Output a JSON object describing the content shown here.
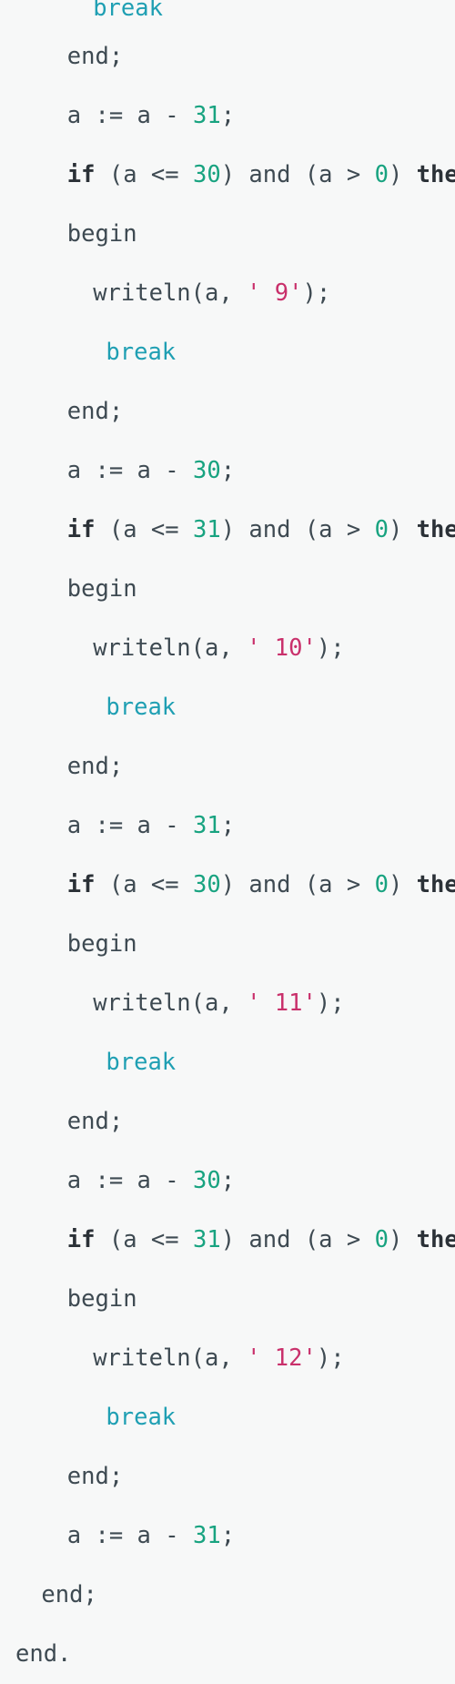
{
  "editor": {
    "language": "Pascal",
    "background_color": "#f7f8f8",
    "colors": {
      "plain": "#3e4a52",
      "keyword": "#2b3137",
      "control": "#1f9fb3",
      "number": "#18a380",
      "string": "#c9306b"
    }
  },
  "code": {
    "lines": [
      {
        "indent": 6,
        "clipped": true,
        "tokens": [
          {
            "type": "control",
            "text": "break"
          }
        ]
      },
      {
        "indent": 4,
        "tokens": [
          {
            "type": "plain",
            "text": "end;"
          }
        ]
      },
      {
        "indent": 4,
        "tokens": [
          {
            "type": "plain",
            "text": "a := a - "
          },
          {
            "type": "number",
            "text": "31"
          },
          {
            "type": "plain",
            "text": ";"
          }
        ]
      },
      {
        "indent": 4,
        "tokens": [
          {
            "type": "keyword",
            "text": "if"
          },
          {
            "type": "plain",
            "text": " (a <= "
          },
          {
            "type": "number",
            "text": "30"
          },
          {
            "type": "plain",
            "text": ") and (a > "
          },
          {
            "type": "number",
            "text": "0"
          },
          {
            "type": "plain",
            "text": ") "
          },
          {
            "type": "keyword",
            "text": "then"
          }
        ]
      },
      {
        "indent": 4,
        "tokens": [
          {
            "type": "plain",
            "text": "begin"
          }
        ]
      },
      {
        "indent": 6,
        "tokens": [
          {
            "type": "plain",
            "text": "writeln(a, "
          },
          {
            "type": "string",
            "text": "' 9'"
          },
          {
            "type": "plain",
            "text": ");"
          }
        ]
      },
      {
        "indent": 7,
        "tokens": [
          {
            "type": "control",
            "text": "break"
          }
        ]
      },
      {
        "indent": 4,
        "tokens": [
          {
            "type": "plain",
            "text": "end;"
          }
        ]
      },
      {
        "indent": 4,
        "tokens": [
          {
            "type": "plain",
            "text": "a := a - "
          },
          {
            "type": "number",
            "text": "30"
          },
          {
            "type": "plain",
            "text": ";"
          }
        ]
      },
      {
        "indent": 4,
        "tokens": [
          {
            "type": "keyword",
            "text": "if"
          },
          {
            "type": "plain",
            "text": " (a <= "
          },
          {
            "type": "number",
            "text": "31"
          },
          {
            "type": "plain",
            "text": ") and (a > "
          },
          {
            "type": "number",
            "text": "0"
          },
          {
            "type": "plain",
            "text": ") "
          },
          {
            "type": "keyword",
            "text": "then"
          }
        ]
      },
      {
        "indent": 4,
        "tokens": [
          {
            "type": "plain",
            "text": "begin"
          }
        ]
      },
      {
        "indent": 6,
        "tokens": [
          {
            "type": "plain",
            "text": "writeln(a, "
          },
          {
            "type": "string",
            "text": "' 10'"
          },
          {
            "type": "plain",
            "text": ");"
          }
        ]
      },
      {
        "indent": 7,
        "tokens": [
          {
            "type": "control",
            "text": "break"
          }
        ]
      },
      {
        "indent": 4,
        "tokens": [
          {
            "type": "plain",
            "text": "end;"
          }
        ]
      },
      {
        "indent": 4,
        "tokens": [
          {
            "type": "plain",
            "text": "a := a - "
          },
          {
            "type": "number",
            "text": "31"
          },
          {
            "type": "plain",
            "text": ";"
          }
        ]
      },
      {
        "indent": 4,
        "tokens": [
          {
            "type": "keyword",
            "text": "if"
          },
          {
            "type": "plain",
            "text": " (a <= "
          },
          {
            "type": "number",
            "text": "30"
          },
          {
            "type": "plain",
            "text": ") and (a > "
          },
          {
            "type": "number",
            "text": "0"
          },
          {
            "type": "plain",
            "text": ") "
          },
          {
            "type": "keyword",
            "text": "then"
          }
        ]
      },
      {
        "indent": 4,
        "tokens": [
          {
            "type": "plain",
            "text": "begin"
          }
        ]
      },
      {
        "indent": 6,
        "tokens": [
          {
            "type": "plain",
            "text": "writeln(a, "
          },
          {
            "type": "string",
            "text": "' 11'"
          },
          {
            "type": "plain",
            "text": ");"
          }
        ]
      },
      {
        "indent": 7,
        "tokens": [
          {
            "type": "control",
            "text": "break"
          }
        ]
      },
      {
        "indent": 4,
        "tokens": [
          {
            "type": "plain",
            "text": "end;"
          }
        ]
      },
      {
        "indent": 4,
        "tokens": [
          {
            "type": "plain",
            "text": "a := a - "
          },
          {
            "type": "number",
            "text": "30"
          },
          {
            "type": "plain",
            "text": ";"
          }
        ]
      },
      {
        "indent": 4,
        "tokens": [
          {
            "type": "keyword",
            "text": "if"
          },
          {
            "type": "plain",
            "text": " (a <= "
          },
          {
            "type": "number",
            "text": "31"
          },
          {
            "type": "plain",
            "text": ") and (a > "
          },
          {
            "type": "number",
            "text": "0"
          },
          {
            "type": "plain",
            "text": ") "
          },
          {
            "type": "keyword",
            "text": "then"
          }
        ]
      },
      {
        "indent": 4,
        "tokens": [
          {
            "type": "plain",
            "text": "begin"
          }
        ]
      },
      {
        "indent": 6,
        "tokens": [
          {
            "type": "plain",
            "text": "writeln(a, "
          },
          {
            "type": "string",
            "text": "' 12'"
          },
          {
            "type": "plain",
            "text": ");"
          }
        ]
      },
      {
        "indent": 7,
        "tokens": [
          {
            "type": "control",
            "text": "break"
          }
        ]
      },
      {
        "indent": 4,
        "tokens": [
          {
            "type": "plain",
            "text": "end;"
          }
        ]
      },
      {
        "indent": 4,
        "tokens": [
          {
            "type": "plain",
            "text": "a := a - "
          },
          {
            "type": "number",
            "text": "31"
          },
          {
            "type": "plain",
            "text": ";"
          }
        ]
      },
      {
        "indent": 2,
        "tokens": [
          {
            "type": "plain",
            "text": "end;"
          }
        ]
      },
      {
        "indent": 0,
        "tokens": [
          {
            "type": "plain",
            "text": "end."
          }
        ]
      }
    ]
  }
}
